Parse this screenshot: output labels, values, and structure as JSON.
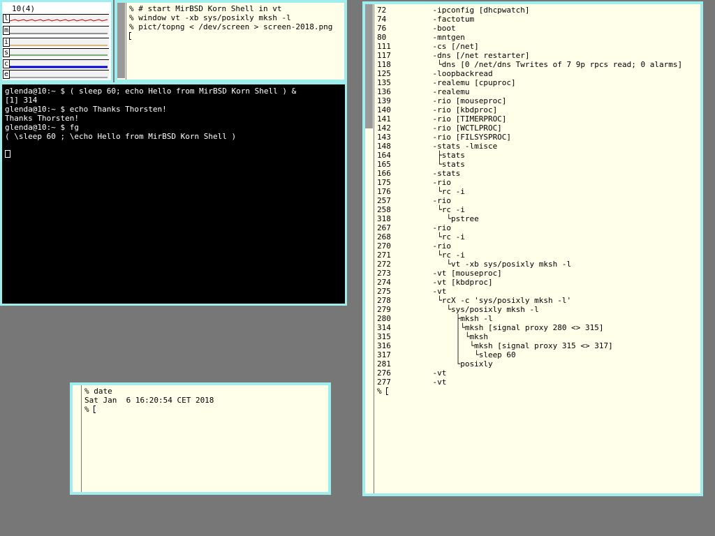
{
  "stats": {
    "header": "10(4)",
    "rows": [
      {
        "label": "l",
        "color": "#cc0000"
      },
      {
        "label": "m",
        "color": "#333333"
      },
      {
        "label": "i",
        "color": "#b8860b"
      },
      {
        "label": "s",
        "color": "#006600"
      },
      {
        "label": "c",
        "color": "#0000cc"
      },
      {
        "label": "e",
        "color": "#555555"
      }
    ]
  },
  "top_terminal": {
    "lines": [
      "% # start MirBSD Korn Shell in vt",
      "% window vt -xb sys/posixly mksh -l",
      "% pict/topng < /dev/screen > screen-2018.png"
    ]
  },
  "vt": {
    "lines": [
      "glenda@10:~ $ ( sleep 60; echo Hello from MirBSD Korn Shell ) &",
      "[1] 314",
      "glenda@10:~ $ echo Thanks Thorsten!",
      "Thanks Thorsten!",
      "glenda@10:~ $ fg",
      "( \\sleep 60 ; \\echo Hello from MirBSD Korn Shell )"
    ]
  },
  "date_window": {
    "lines": [
      "% date",
      "Sat Jan  6 16:20:54 CET 2018"
    ],
    "prompt": "%"
  },
  "pstree_window": {
    "lines": [
      "72          -ipconfig [dhcpwatch]",
      "74          -factotum",
      "76          -boot",
      "80          -mntgen",
      "111         -cs [/net]",
      "117         -dns [/net restarter]",
      "118          └dns [0 /net/dns Twrites of 7 9p rpcs read; 0 alarms]",
      "125         -loopbackread",
      "135         -realemu [cpuproc]",
      "136         -realemu",
      "139         -rio [mouseproc]",
      "140         -rio [kbdproc]",
      "141         -rio [TIMERPROC]",
      "142         -rio [WCTLPROC]",
      "143         -rio [FILSYSPROC]",
      "148         -stats -lmisce",
      "164          ├stats",
      "165          └stats",
      "166         -stats",
      "175         -rio",
      "176          └rc -i",
      "257         -rio",
      "258          └rc -i",
      "318            └pstree",
      "267         -rio",
      "268          └rc -i",
      "270         -rio",
      "271          └rc -i",
      "272            └vt -xb sys/posixly mksh -l",
      "273         -vt [mouseproc]",
      "274         -vt [kbdproc]",
      "275         -vt",
      "278          └rcX -c 'sys/posixly mksh -l'",
      "279            └sys/posixly mksh -l",
      "280              ├mksh -l",
      "314              │└mksh [signal proxy 280 <> 315]",
      "315              │ └mksh",
      "316              │  └mksh [signal proxy 315 <> 317]",
      "317              │   └sleep 60",
      "281              └posixly",
      "276         -vt",
      "277         -vt"
    ],
    "prompt": "%"
  }
}
